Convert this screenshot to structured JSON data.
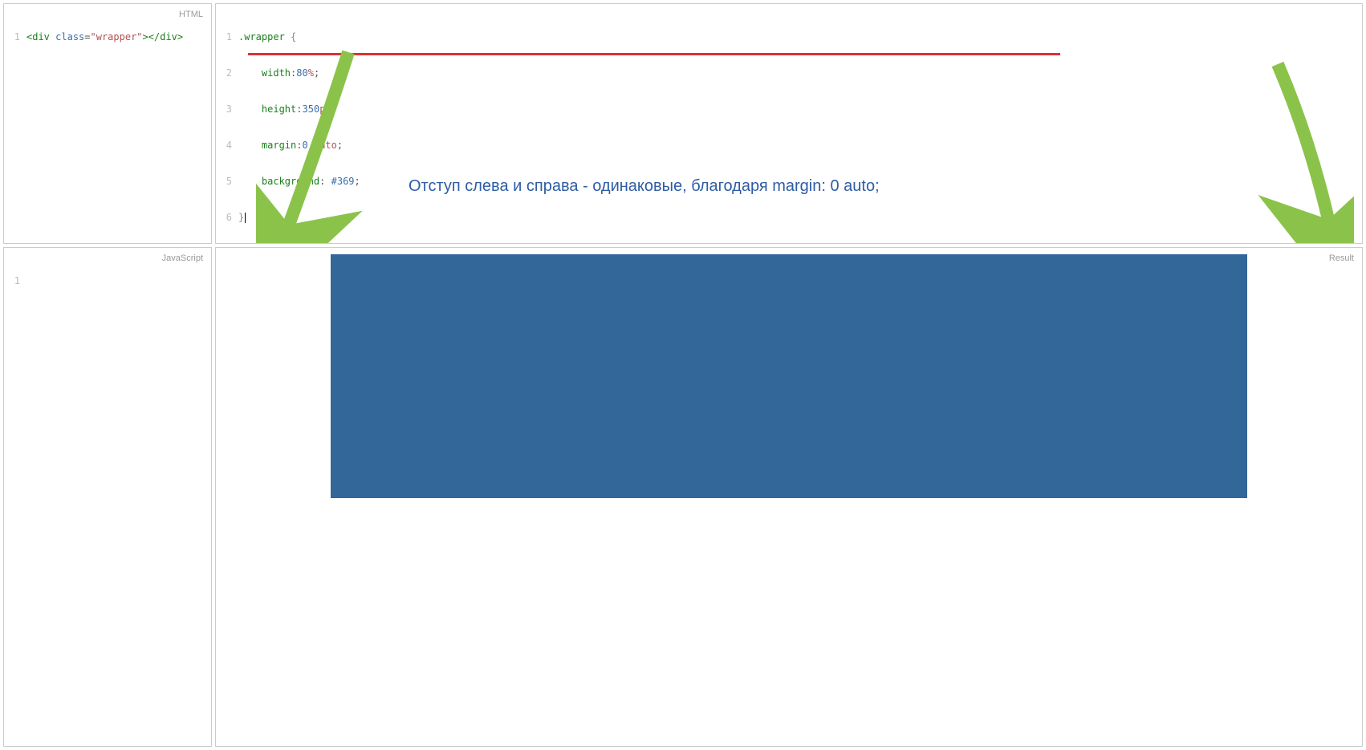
{
  "panes": {
    "html": {
      "label": "HTML"
    },
    "css": {
      "label": ""
    },
    "js": {
      "label": "JavaScript"
    },
    "result": {
      "label": "Result"
    }
  },
  "html_code": {
    "ln1": "1",
    "tag_open": "<div",
    "attr": "class",
    "eq": "=",
    "val": "\"wrapper\"",
    "tag_mid": ">",
    "tag_close": "</div>"
  },
  "css_code": {
    "ln1": "1",
    "ln2": "2",
    "ln3": "3",
    "ln4": "4",
    "ln5": "5",
    "ln6": "6",
    "selector": ".wrapper",
    "open": "{",
    "prop_width": "width",
    "val_width_num": "80",
    "val_width_unit": "%",
    "prop_height": "height",
    "val_height_num": "350",
    "val_height_unit": "px",
    "prop_margin": "margin",
    "val_margin_num": "0",
    "val_margin_auto": "auto",
    "prop_bg": "background",
    "val_bg": "#369",
    "close": "}",
    "colon": ":",
    "semi": ";"
  },
  "js_code": {
    "ln1": "1"
  },
  "annotation": {
    "text": "Отступ слева и справа - одинаковые, благодаря margin: 0 auto;"
  },
  "result": {
    "box_color": "#336699"
  }
}
